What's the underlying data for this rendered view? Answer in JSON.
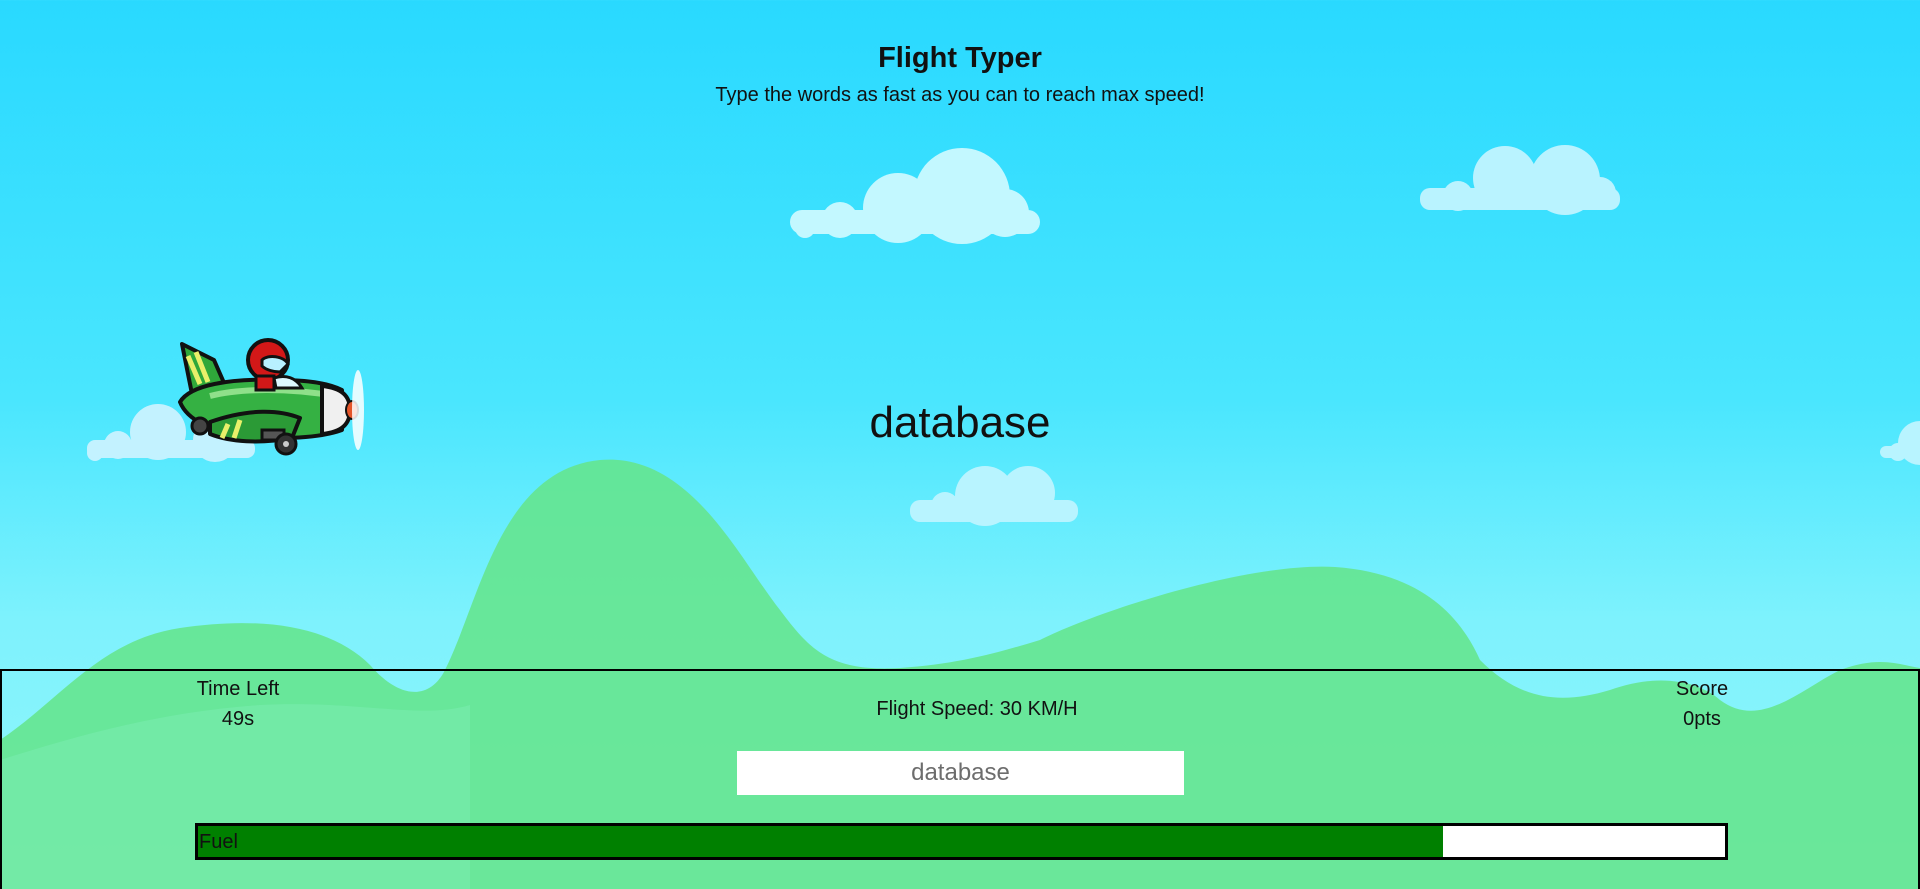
{
  "header": {
    "title": "Flight Typer",
    "subtitle": "Type the words as fast as you can to reach max speed!"
  },
  "game": {
    "current_word": "database"
  },
  "hud": {
    "time_label": "Time Left",
    "time_value": "49s",
    "speed_text": "Flight Speed: 30 KM/H",
    "score_label": "Score",
    "score_value": "0pts",
    "input_placeholder": "database",
    "input_value": "",
    "fuel_label": "Fuel",
    "fuel_fraction": 0.815
  },
  "colors": {
    "sky_top": "#29d9ff",
    "sky_bottom": "#93f6fb",
    "hill": "#6ee89a",
    "cloud": "#c3f8ff",
    "fuel": "#008000",
    "plane_body": "#2fa83a",
    "pilot_helmet": "#d31818"
  }
}
